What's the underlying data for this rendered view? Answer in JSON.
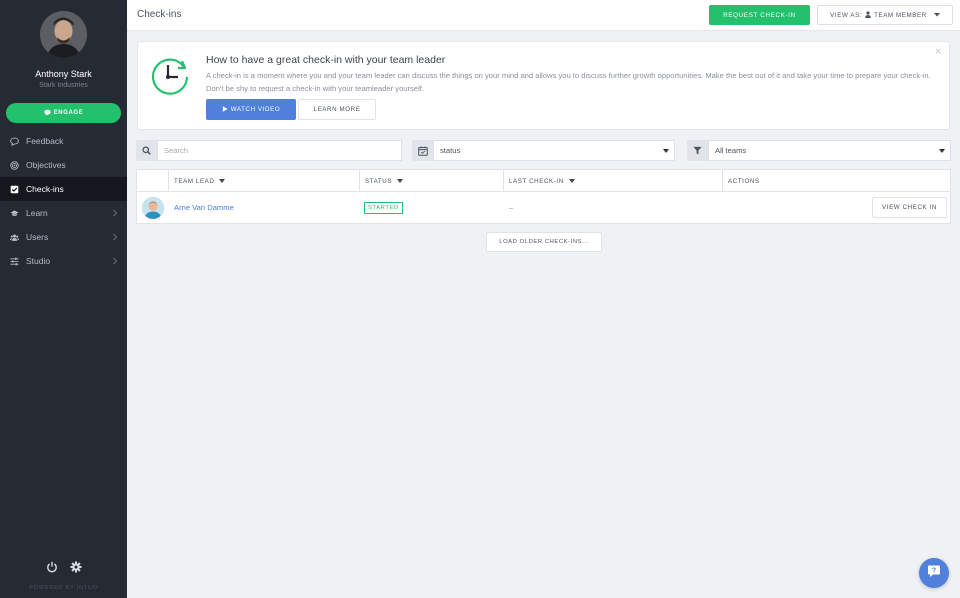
{
  "sidebar": {
    "user_name": "Anthony Stark",
    "user_company": "Stark Industries",
    "engage_label": "ENGAGE",
    "items": [
      {
        "label": "Feedback",
        "icon": "comment-icon",
        "has_chevron": false
      },
      {
        "label": "Objectives",
        "icon": "target-icon",
        "has_chevron": false
      },
      {
        "label": "Check-ins",
        "icon": "checkbox-icon",
        "has_chevron": false,
        "active": true
      },
      {
        "label": "Learn",
        "icon": "graduation-cap-icon",
        "has_chevron": true
      },
      {
        "label": "Users",
        "icon": "users-icon",
        "has_chevron": true
      },
      {
        "label": "Studio",
        "icon": "sliders-icon",
        "has_chevron": true
      }
    ],
    "powered_by": "POWERED BY INTUO"
  },
  "header": {
    "title": "Check-ins",
    "request_label": "REQUEST CHECK-IN",
    "view_as_label": "VIEW AS:",
    "view_as_value": "TEAM MEMBER"
  },
  "banner": {
    "title": "How to have a great check-in with your team leader",
    "text": "A check-in is a moment where you and your team leader can discuss the things on your mind and allows you to discuss further growth opportunities. Make the best out of it and take your time to prepare your check-in. Don't be shy to request a check-in with your teamleader yourself.",
    "watch_label": "WATCH VIDEO",
    "learn_label": "LEARN MORE",
    "close_glyph": "×"
  },
  "filters": {
    "search_placeholder": "Search",
    "status_value": "status",
    "teams_value": "All teams"
  },
  "table": {
    "columns": [
      "TEAM LEAD",
      "STATUS",
      "LAST CHECK-IN",
      "ACTIONS"
    ],
    "rows": [
      {
        "team_lead": "Arne Van Damme",
        "status": "STARTED",
        "last_checkin": "–",
        "action": "VIEW CHECK IN"
      }
    ]
  },
  "load_older_label": "LOAD OLDER CHECK-INS...",
  "colors": {
    "accent_green": "#23c06e",
    "accent_blue": "#4f80dc",
    "sidebar_bg": "#262a33"
  }
}
